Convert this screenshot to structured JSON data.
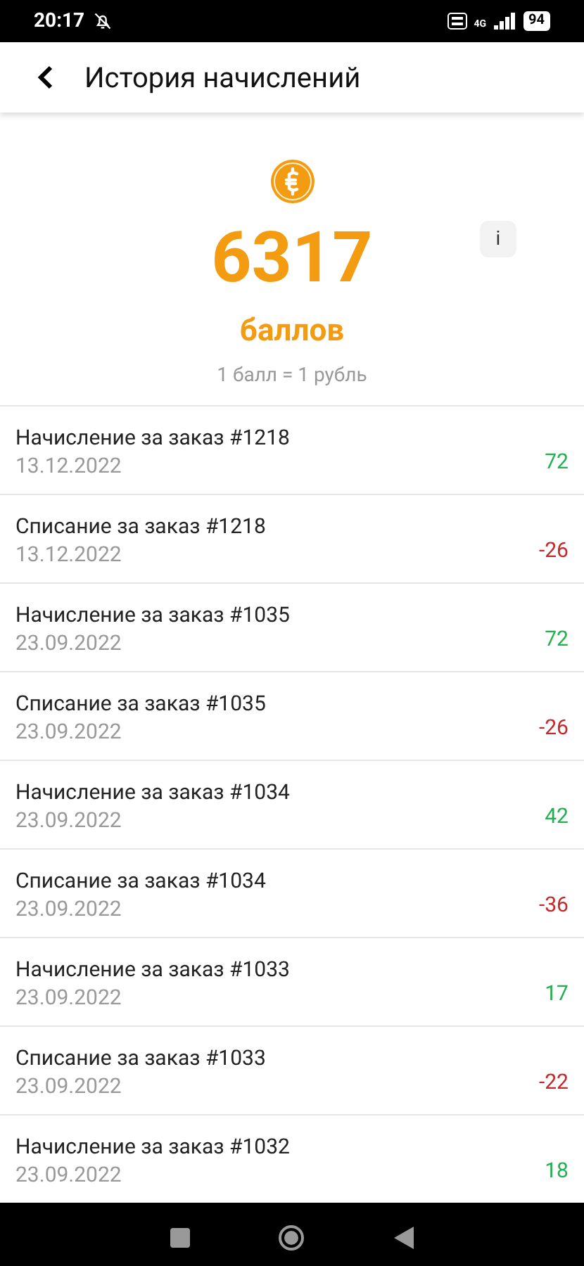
{
  "status_bar": {
    "time": "20:17",
    "network": "4G",
    "battery": "94"
  },
  "header": {
    "title": "История начислений"
  },
  "balance": {
    "amount": "6317",
    "unit": "баллов",
    "rate": "1 балл = 1 рубль",
    "info_button": "i"
  },
  "transactions": [
    {
      "title": "Начисление за заказ #1218",
      "date": "13.12.2022",
      "amount": "72",
      "kind": "credit"
    },
    {
      "title": "Списание за заказ #1218",
      "date": "13.12.2022",
      "amount": "-26",
      "kind": "debit"
    },
    {
      "title": "Начисление за заказ #1035",
      "date": "23.09.2022",
      "amount": "72",
      "kind": "credit"
    },
    {
      "title": "Списание за заказ #1035",
      "date": "23.09.2022",
      "amount": "-26",
      "kind": "debit"
    },
    {
      "title": "Начисление за заказ #1034",
      "date": "23.09.2022",
      "amount": "42",
      "kind": "credit"
    },
    {
      "title": "Списание за заказ #1034",
      "date": "23.09.2022",
      "amount": "-36",
      "kind": "debit"
    },
    {
      "title": "Начисление за заказ #1033",
      "date": "23.09.2022",
      "amount": "17",
      "kind": "credit"
    },
    {
      "title": "Списание за заказ #1033",
      "date": "23.09.2022",
      "amount": "-22",
      "kind": "debit"
    },
    {
      "title": "Начисление за заказ #1032",
      "date": "23.09.2022",
      "amount": "18",
      "kind": "credit"
    }
  ]
}
